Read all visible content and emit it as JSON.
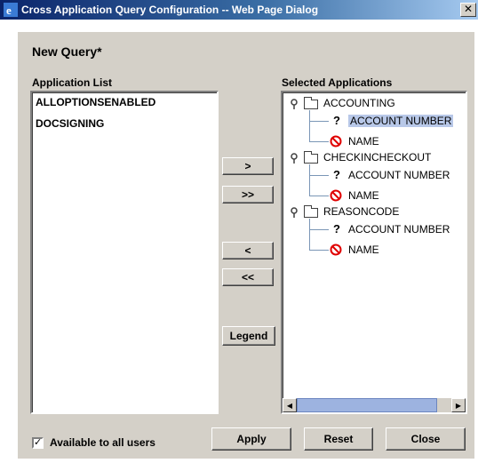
{
  "window": {
    "title": "Cross Application Query Configuration -- Web Page Dialog",
    "close_glyph": "✕"
  },
  "heading": "New Query*",
  "application_list": {
    "label": "Application List",
    "items": [
      "ALLOPTIONSENABLED",
      "DOCSIGNING"
    ]
  },
  "selected_applications": {
    "label": "Selected Applications",
    "tree": [
      {
        "name": "ACCOUNTING",
        "children": [
          {
            "name": "ACCOUNT NUMBER",
            "icon": "question-icon",
            "selected": true
          },
          {
            "name": "NAME",
            "icon": "no-entry-icon"
          }
        ]
      },
      {
        "name": "CHECKINCHECKOUT",
        "children": [
          {
            "name": "ACCOUNT NUMBER",
            "icon": "question-icon"
          },
          {
            "name": "NAME",
            "icon": "no-entry-icon"
          }
        ]
      },
      {
        "name": "REASONCODE",
        "children": [
          {
            "name": "ACCOUNT NUMBER",
            "icon": "question-icon"
          },
          {
            "name": "NAME",
            "icon": "no-entry-icon"
          }
        ]
      }
    ]
  },
  "transfer_buttons": {
    "add": ">",
    "add_all": ">>",
    "remove": "<",
    "remove_all": "<<",
    "legend": "Legend"
  },
  "footer": {
    "available_checkbox": {
      "label": "Available to all users",
      "checked": true,
      "glyph": "✓"
    },
    "apply": "Apply",
    "reset": "Reset",
    "close": "Close"
  },
  "scrollbar": {
    "left_arrow": "◀",
    "right_arrow": "▶"
  },
  "colors": {
    "title_gradient_start": "#0a246a",
    "dialog_bg": "#d4d0c8",
    "selection": "#b8c8e8",
    "no_entry": "#e00000"
  }
}
